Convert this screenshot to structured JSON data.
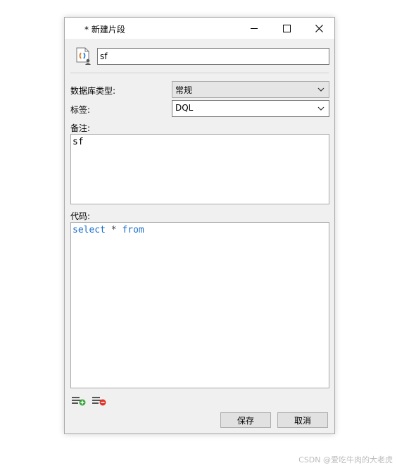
{
  "window": {
    "title": "* 新建片段"
  },
  "snippet": {
    "name_value": "sf"
  },
  "fields": {
    "db_type_label": "数据库类型:",
    "db_type_value": "常规",
    "tag_label": "标签:",
    "tag_value": "DQL",
    "note_label": "备注:",
    "note_value": "sf",
    "code_label": "代码:",
    "code_tokens": {
      "kw1": "select",
      "op": " * ",
      "kw2": "from"
    }
  },
  "buttons": {
    "save": "保存",
    "cancel": "取消"
  },
  "watermark": "CSDN @爱吃牛肉的大老虎",
  "colors": {
    "keyword": "#1a6ecb",
    "add_icon": "#3aa63a",
    "remove_icon": "#e0352b"
  }
}
